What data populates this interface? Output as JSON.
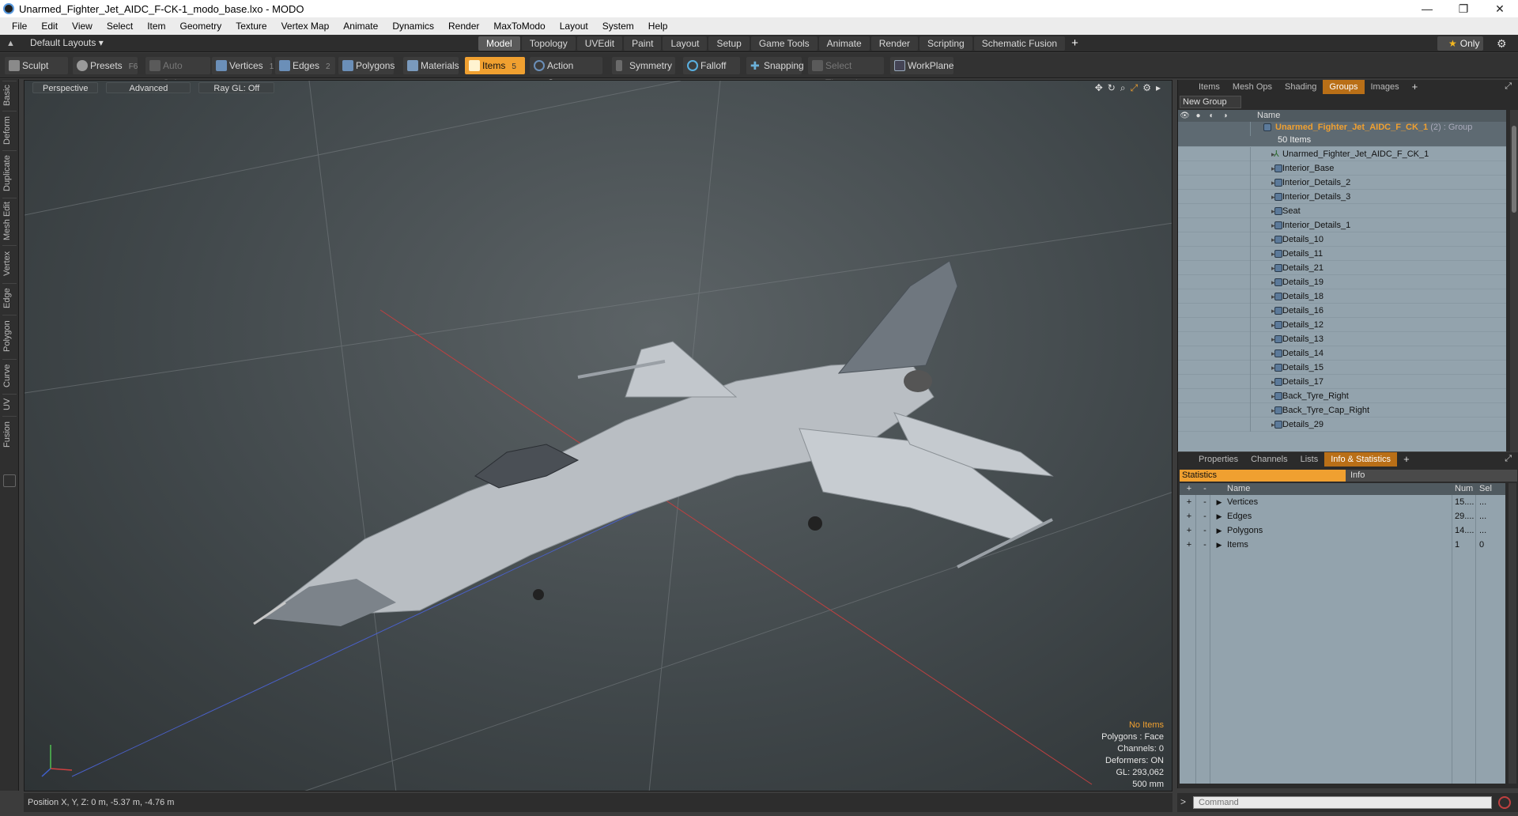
{
  "window": {
    "title": "Unarmed_Fighter_Jet_AIDC_F-CK-1_modo_base.lxo - MODO",
    "min": "—",
    "max": "❐",
    "close": "✕"
  },
  "menu": [
    "File",
    "Edit",
    "View",
    "Select",
    "Item",
    "Geometry",
    "Texture",
    "Vertex Map",
    "Animate",
    "Dynamics",
    "Render",
    "MaxToModo",
    "Layout",
    "System",
    "Help"
  ],
  "layout": {
    "selector": "Default Layouts ▾",
    "tabs": [
      "Model",
      "Topology",
      "UVEdit",
      "Paint",
      "Layout",
      "Setup",
      "Game Tools",
      "Animate",
      "Render",
      "Scripting",
      "Schematic Fusion"
    ],
    "active_tab": "Model",
    "plus": "+",
    "only": "Only"
  },
  "toolbar": {
    "sculpt": "Sculpt",
    "presets": "Presets",
    "presets_key": "F6",
    "auto_select": "Auto Select",
    "vertices": "Vertices",
    "vertices_key": "1",
    "edges": "Edges",
    "edges_key": "2",
    "polygons": "Polygons",
    "materials": "Materials",
    "items": "Items",
    "items_key": "5",
    "action_center": "Action Center",
    "symmetry": "Symmetry",
    "falloff": "Falloff",
    "snapping": "Snapping",
    "select_through": "Select Through",
    "workplane": "WorkPlane"
  },
  "left_tabs": [
    "Basic",
    "Deform",
    "Duplicate",
    "Mesh Edit",
    "Vertex",
    "Edge",
    "Polygon",
    "Curve",
    "UV",
    "Fusion"
  ],
  "viewport": {
    "view": "Perspective",
    "shading": "Advanced",
    "raygl": "Ray GL: Off",
    "info": {
      "items": "No Items",
      "polygons": "Polygons : Face",
      "channels": "Channels: 0",
      "deformers": "Deformers: ON",
      "gl": "GL: 293,062",
      "scale": "500 mm"
    },
    "colors": {
      "accent": "#f0a030",
      "jet_body": "#b9bec3",
      "grid": "#7a8084"
    }
  },
  "status": {
    "position": "Position X, Y, Z:  0 m, -5.37 m, -4.76 m"
  },
  "groups_panel": {
    "tabs": [
      "Items",
      "Mesh Ops",
      "Shading",
      "Groups",
      "Images"
    ],
    "active_tab": "Groups",
    "plus": "+",
    "new_group": "New Group",
    "name_header": "Name",
    "root": {
      "name": "Unarmed_Fighter_Jet_AIDC_F_CK_1",
      "suffix": "(2) : Group",
      "count": "50 Items"
    },
    "items": [
      "Unarmed_Fighter_Jet_AIDC_F_CK_1",
      "Interior_Base",
      "Interior_Details_2",
      "Interior_Details_3",
      "Seat",
      "Interior_Details_1",
      "Details_10",
      "Details_11",
      "Details_21",
      "Details_19",
      "Details_18",
      "Details_16",
      "Details_12",
      "Details_13",
      "Details_14",
      "Details_15",
      "Details_17",
      "Back_Tyre_Right",
      "Back_Tyre_Cap_Right",
      "Details_29"
    ]
  },
  "stats_panel": {
    "tabs": [
      "Properties",
      "Channels",
      "Lists",
      "Info & Statistics"
    ],
    "active_tab": "Info & Statistics",
    "plus": "+",
    "sub_statistics": "Statistics",
    "sub_info": "Info",
    "headers": {
      "add": "+",
      "remove": "-",
      "name": "Name",
      "num": "Num",
      "sel": "Sel"
    },
    "rows": [
      {
        "name": "Vertices",
        "num": "15....",
        "sel": "..."
      },
      {
        "name": "Edges",
        "num": "29....",
        "sel": "..."
      },
      {
        "name": "Polygons",
        "num": "14....",
        "sel": "..."
      },
      {
        "name": "Items",
        "num": "1",
        "sel": "0"
      }
    ]
  },
  "command": {
    "placeholder": "Command",
    "prompt": ">"
  }
}
